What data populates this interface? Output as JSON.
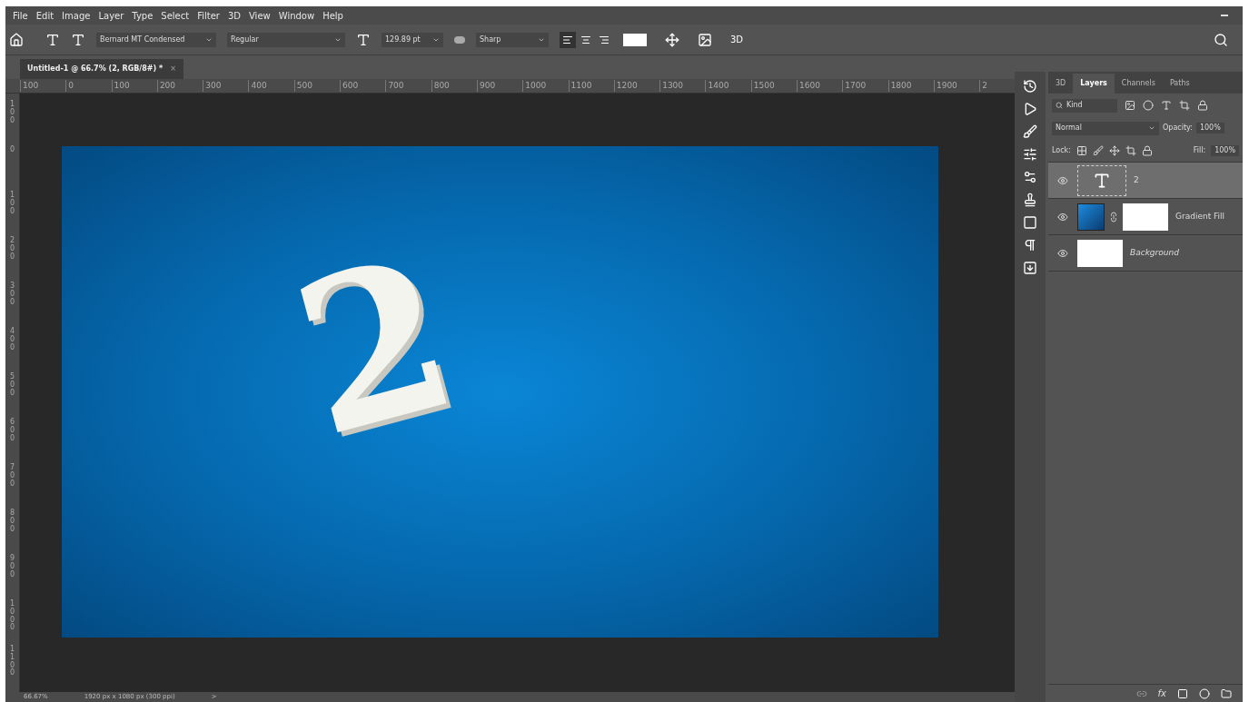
{
  "menu": [
    "File",
    "Edit",
    "Image",
    "Layer",
    "Type",
    "Select",
    "Filter",
    "3D",
    "View",
    "Window",
    "Help"
  ],
  "options": {
    "font_family": "Bernard MT Condensed",
    "font_style": "Regular",
    "font_size": "129.89 pt",
    "antialias": "Sharp",
    "align": [
      {
        "kind": "left",
        "selected": true
      },
      {
        "kind": "center",
        "selected": false
      },
      {
        "kind": "right",
        "selected": false
      }
    ],
    "button_3d": "3D"
  },
  "document_tab": {
    "title": "Untitled-1 @ 66.7% (2, RGB/8#) *",
    "close": "×"
  },
  "ruler_h": [
    "100",
    "0",
    "100",
    "200",
    "300",
    "400",
    "500",
    "600",
    "700",
    "800",
    "900",
    "1000",
    "1100",
    "1200",
    "1300",
    "1400",
    "1500",
    "1600",
    "1700",
    "1800",
    "1900",
    "2"
  ],
  "ruler_v": [
    "100",
    "0",
    "100",
    "200",
    "300",
    "400",
    "500",
    "600",
    "700",
    "800",
    "900",
    "1000",
    "1100"
  ],
  "canvas": {
    "text": "2"
  },
  "panel": {
    "tabs": [
      {
        "label": "3D",
        "selected": false
      },
      {
        "label": "Layers",
        "selected": true
      },
      {
        "label": "Channels",
        "selected": false
      },
      {
        "label": "Paths",
        "selected": false
      }
    ],
    "filter": "Kind",
    "blend_mode": "Normal",
    "opacity_label": "Opacity:",
    "opacity": "100%",
    "lock_label": "Lock:",
    "fill_label": "Fill:",
    "fill": "100%",
    "layers": [
      {
        "kind": "text",
        "name": "2",
        "visible": true,
        "selected": true
      },
      {
        "kind": "gradient",
        "name": "Gradient Fill",
        "visible": true,
        "selected": false
      },
      {
        "kind": "background",
        "name": "Background",
        "visible": true,
        "selected": false
      }
    ],
    "footer_fx": "fx"
  },
  "status_bar": {
    "zoom": "66.67%",
    "size": "1920 px x 1080 px (300 ppi)",
    "caret": ">"
  }
}
